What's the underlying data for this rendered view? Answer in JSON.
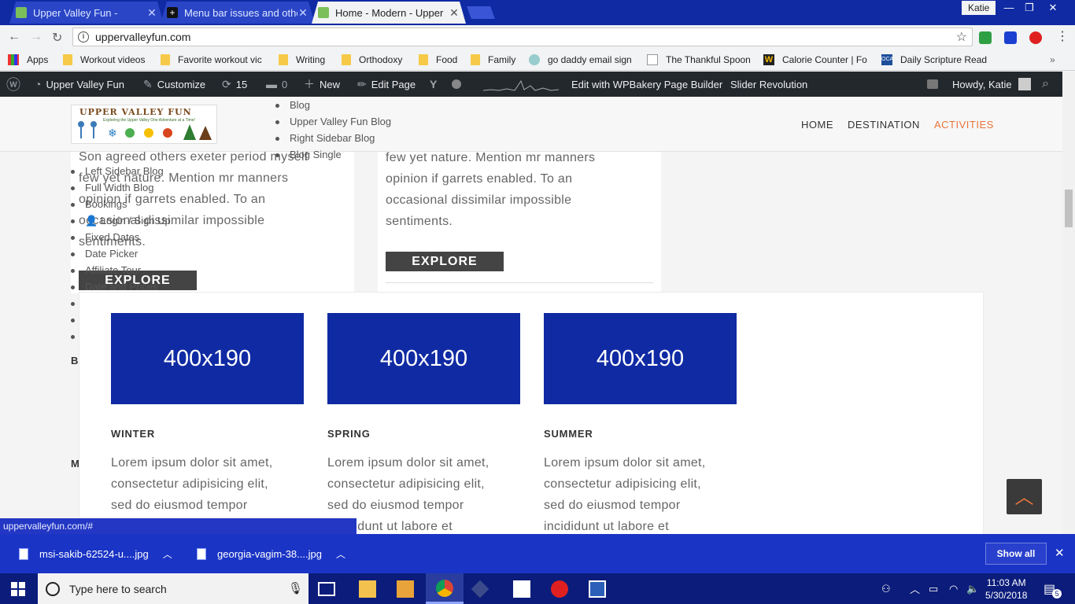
{
  "browser": {
    "tabs": [
      {
        "title": "Upper Valley Fun -",
        "active": false
      },
      {
        "title": "Menu bar issues and othe",
        "active": false
      },
      {
        "title": "Home - Modern - Upper",
        "active": true
      }
    ],
    "user": "Katie",
    "url": "uppervalleyfun.com",
    "status_url": "uppervalleyfun.com/#"
  },
  "bookmarks": [
    "Apps",
    "Workout videos",
    "Favorite workout vic",
    "Writing",
    "Orthodoxy",
    "Food",
    "Family",
    "go daddy email sign",
    "The Thankful Spoon",
    "Calorie Counter | Fo",
    "Daily Scripture Read"
  ],
  "bookmark_overflow": "»",
  "wpbar": {
    "site": "Upper Valley Fun",
    "customize": "Customize",
    "updates": "15",
    "comments": "0",
    "new": "New",
    "edit_page": "Edit Page",
    "wpbakery": "Edit with WPBakery Page Builder",
    "slider": "Slider Revolution",
    "howdy": "Howdy, Katie"
  },
  "site": {
    "logo_title": "UPPER VALLEY FUN",
    "logo_tagline": "Exploring the Upper Valley One Adventure at a Time!",
    "nav": [
      "HOME",
      "DESTINATION",
      "ACTIVITIES"
    ],
    "blog_menu": [
      "Blog",
      "Upper Valley Fun Blog",
      "Right Sidebar Blog",
      "Blog Single"
    ],
    "left_menu": [
      "Left Sidebar Blog",
      "Full Width Blog",
      "Bookings",
      "Login / Sign Up",
      "Fixed Dates",
      "Date Picker",
      "Affiliate Tour",
      "Date and Prices"
    ],
    "left_para": [
      "Son agreed others exeter period myself",
      "few yet nature. Mention mr manners",
      "opinion if garrets enabled. To an",
      "occasional dissimilar impossible",
      "sentiments."
    ],
    "right_para": [
      "few yet nature. Mention mr manners",
      "opinion if garrets enabled. To an",
      "occasional dissimilar impossible",
      "sentiments."
    ],
    "explore": "EXPLORE",
    "left_letters": [
      "B",
      "M"
    ],
    "seasons": [
      {
        "placeholder": "400x190",
        "name": "WINTER",
        "text": [
          "Lorem ipsum dolor sit amet,",
          "consectetur adipisicing elit,",
          "sed do eiusmod tempor",
          ""
        ]
      },
      {
        "placeholder": "400x190",
        "name": "SPRING",
        "text": [
          "Lorem ipsum dolor sit amet,",
          "consectetur adipisicing elit,",
          "sed do eiusmod tempor",
          "incididunt ut labore et"
        ]
      },
      {
        "placeholder": "400x190",
        "name": "SUMMER",
        "text": [
          "Lorem ipsum dolor sit amet,",
          "consectetur adipisicing elit,",
          "sed do eiusmod tempor",
          "incididunt ut labore et"
        ]
      }
    ]
  },
  "downloads": [
    {
      "name": "msi-sakib-62524-u....jpg"
    },
    {
      "name": "georgia-vagim-38....jpg"
    }
  ],
  "downloads_show_all": "Show all",
  "taskbar": {
    "search_placeholder": "Type here to search",
    "time": "11:03 AM",
    "date": "5/30/2018",
    "notifications": "5"
  },
  "colors": {
    "chrome_blue": "#0f2aa3",
    "accent_orange": "#e8743b",
    "placeholder_blue": "#0f2aa3",
    "wp_dark": "#23282d"
  }
}
